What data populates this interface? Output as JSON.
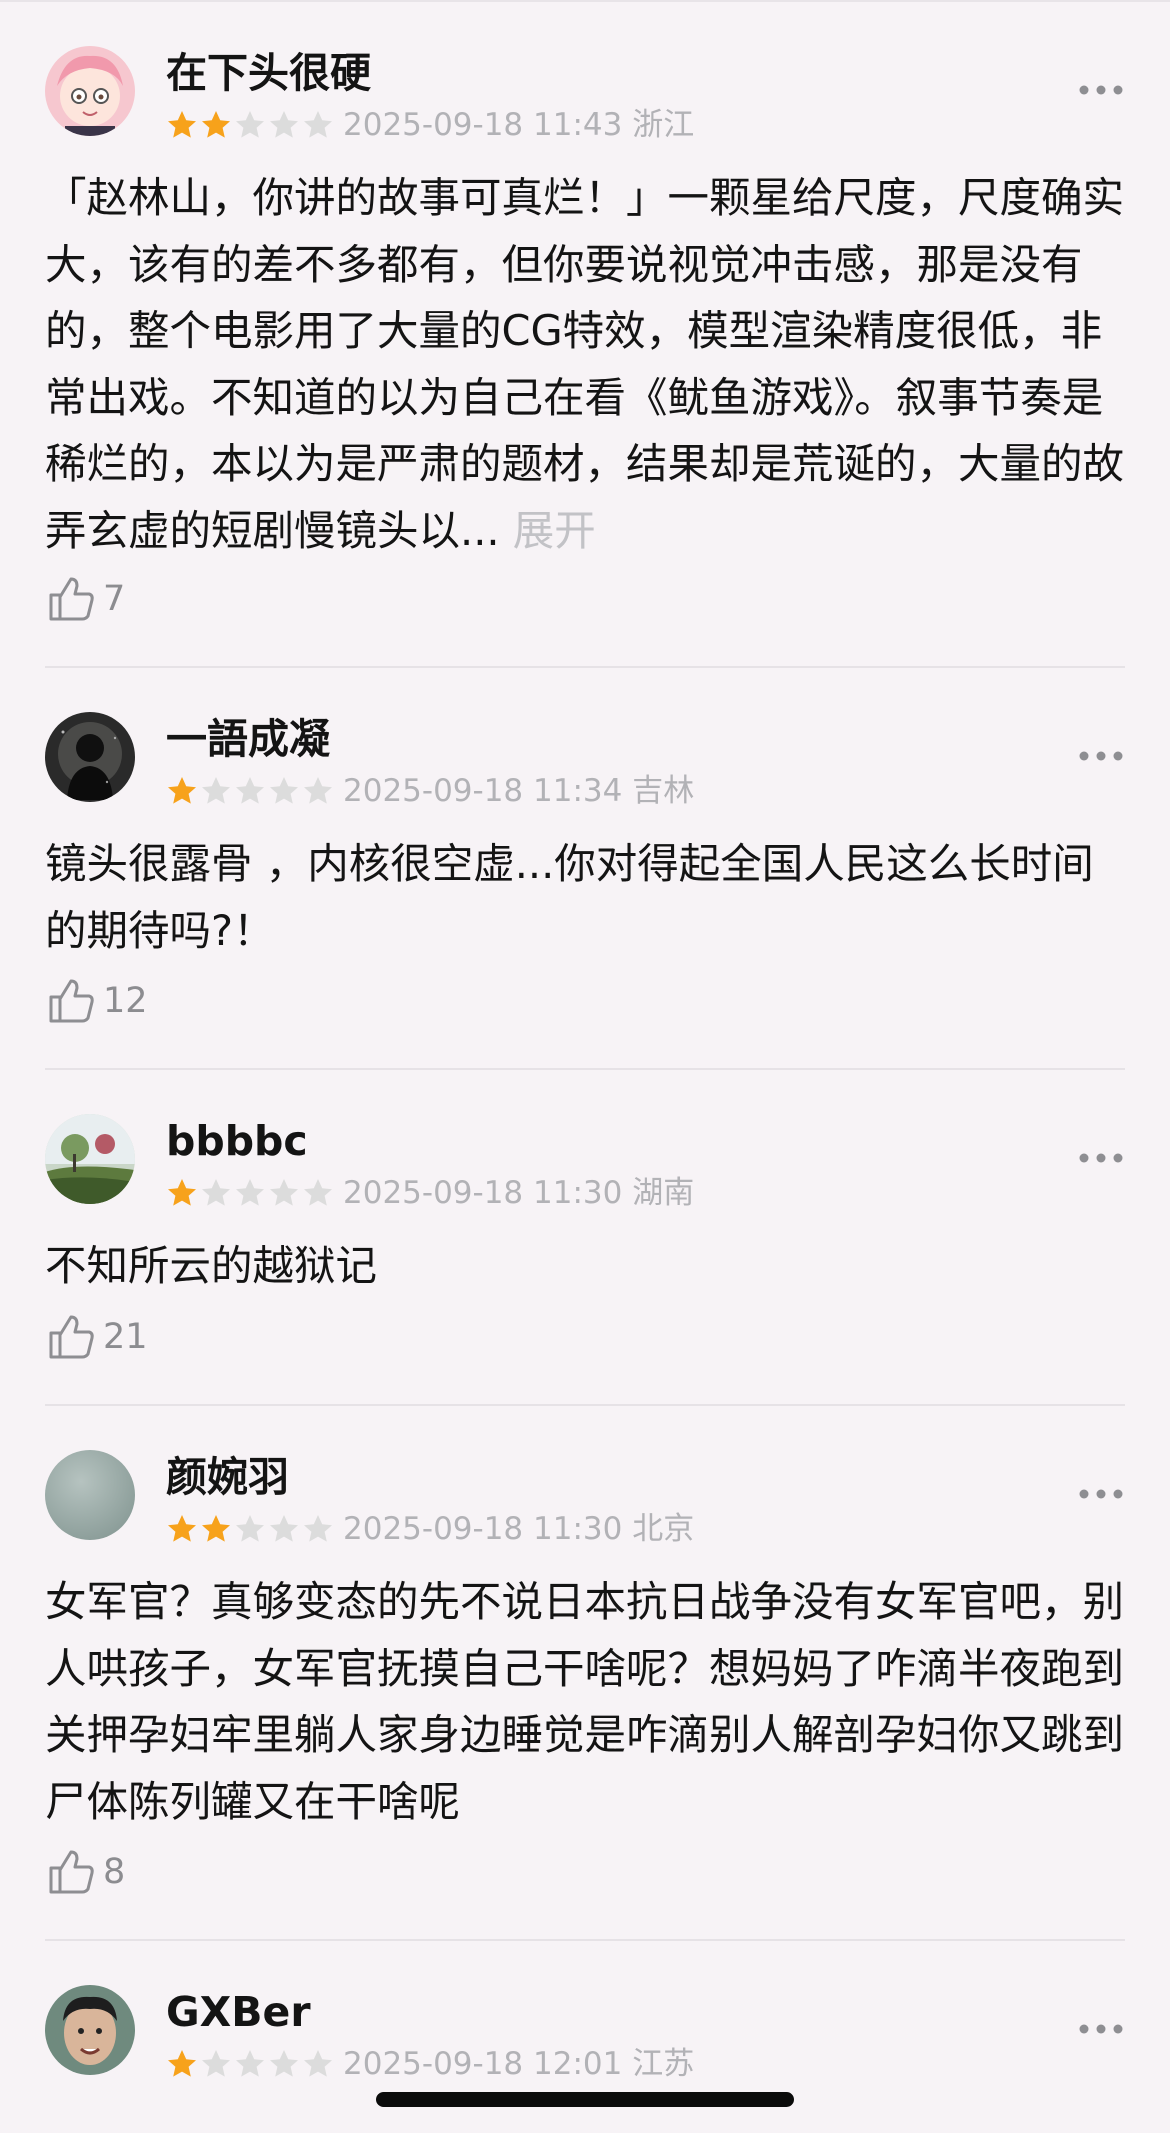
{
  "reviews": [
    {
      "name": "在下头很硬",
      "rating": 2,
      "datetime": "2025-09-18 11:43",
      "location": "浙江",
      "text": "「赵林山，你讲的故事可真烂！」一颗星给尺度，尺度确实大，该有的差不多都有，但你要说视觉冲击感，那是没有的，整个电影用了大量的CG特效，模型渲染精度很低，非常出戏。不知道的以为自己在看《鱿鱼游戏》。叙事节奏是稀烂的，本以为是严肃的题材，结果却是荒诞的，大量的故弄玄虚的短剧慢镜头以...",
      "expand_label": "展开",
      "likes": "7"
    },
    {
      "name": "一語成凝",
      "rating": 1,
      "datetime": "2025-09-18 11:34",
      "location": "吉林",
      "text": "镜头很露骨 ，内核很空虚...你对得起全国人民这么长时间的期待吗?！",
      "likes": "12"
    },
    {
      "name": "bbbbc",
      "rating": 1,
      "datetime": "2025-09-18 11:30",
      "location": "湖南",
      "text": "不知所云的越狱记",
      "likes": "21"
    },
    {
      "name": "颜婉羽",
      "rating": 2,
      "datetime": "2025-09-18 11:30",
      "location": "北京",
      "text": "女军官？真够变态的先不说日本抗日战争没有女军官吧，别人哄孩子，女军官抚摸自己干啥呢？想妈妈了咋滴半夜跑到关押孕妇牢里躺人家身边睡觉是咋滴别人解剖孕妇你又跳到尸体陈列罐又在干啥呢",
      "likes": "8"
    },
    {
      "name": "GXBer",
      "rating": 1,
      "datetime": "2025-09-18 12:01",
      "location": "江苏"
    }
  ],
  "colors": {
    "background": "#f7f3f6",
    "star_filled": "#f7a21b",
    "star_empty": "#dcdcdc",
    "meta_text": "#b2b2b6",
    "expand_text": "#c2c2c6"
  },
  "icons": {
    "like": "thumbs-up-icon",
    "more": "more-dots-icon",
    "star": "star-icon"
  }
}
